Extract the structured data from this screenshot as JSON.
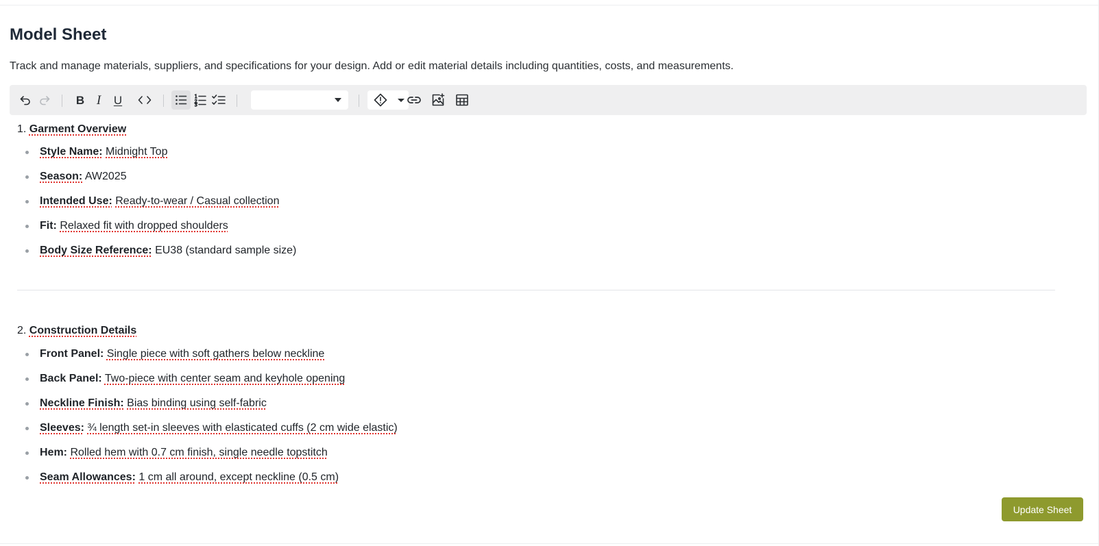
{
  "page": {
    "title": "Model Sheet",
    "description": "Track and manage materials, suppliers, and specifications for your design. Add or edit material details including quantities, costs, and measurements."
  },
  "toolbar": {
    "bold_label": "B",
    "italic_label": "I",
    "underline_label": "U",
    "format_select_value": "",
    "icons": [
      "undo-icon",
      "redo-icon",
      "bold-icon",
      "italic-icon",
      "underline-icon",
      "code-icon",
      "bullet-list-icon",
      "numbered-list-icon",
      "checklist-icon",
      "chevron-down-icon",
      "highlight-icon",
      "link-icon",
      "image-icon",
      "table-icon"
    ]
  },
  "sections": [
    {
      "number": "1.",
      "title": "Garment Overview",
      "items": [
        {
          "label": "Style Name:",
          "value": "Midnight Top"
        },
        {
          "label": "Season:",
          "value": "AW2025"
        },
        {
          "label": "Intended Use:",
          "value": "Ready-to-wear / Casual collection"
        },
        {
          "label": "Fit:",
          "value": "Relaxed fit with dropped shoulders"
        },
        {
          "label": "Body Size Reference:",
          "value": "EU38 (standard sample size)"
        }
      ]
    },
    {
      "number": "2.",
      "title": "Construction Details",
      "items": [
        {
          "label": "Front Panel:",
          "value": "Single piece with soft gathers below neckline"
        },
        {
          "label": "Back Panel:",
          "value": "Two-piece with center seam and keyhole opening"
        },
        {
          "label": "Neckline Finish:",
          "value": "Bias binding using self-fabric"
        },
        {
          "label": "Sleeves:",
          "value": "¾ length set-in sleeves with elasticated cuffs (2 cm wide elastic)"
        },
        {
          "label": "Hem:",
          "value": "Rolled hem with 0.7 cm finish, single needle topstitch"
        },
        {
          "label": "Seam Allowances:",
          "value": "1 cm all around, except neckline (0.5 cm)"
        }
      ]
    }
  ],
  "actions": {
    "update_label": "Update Sheet"
  },
  "colors": {
    "accent": "#8e9a2e",
    "toolbar_bg": "#efeff0",
    "spellcheck": "#e0322d"
  }
}
